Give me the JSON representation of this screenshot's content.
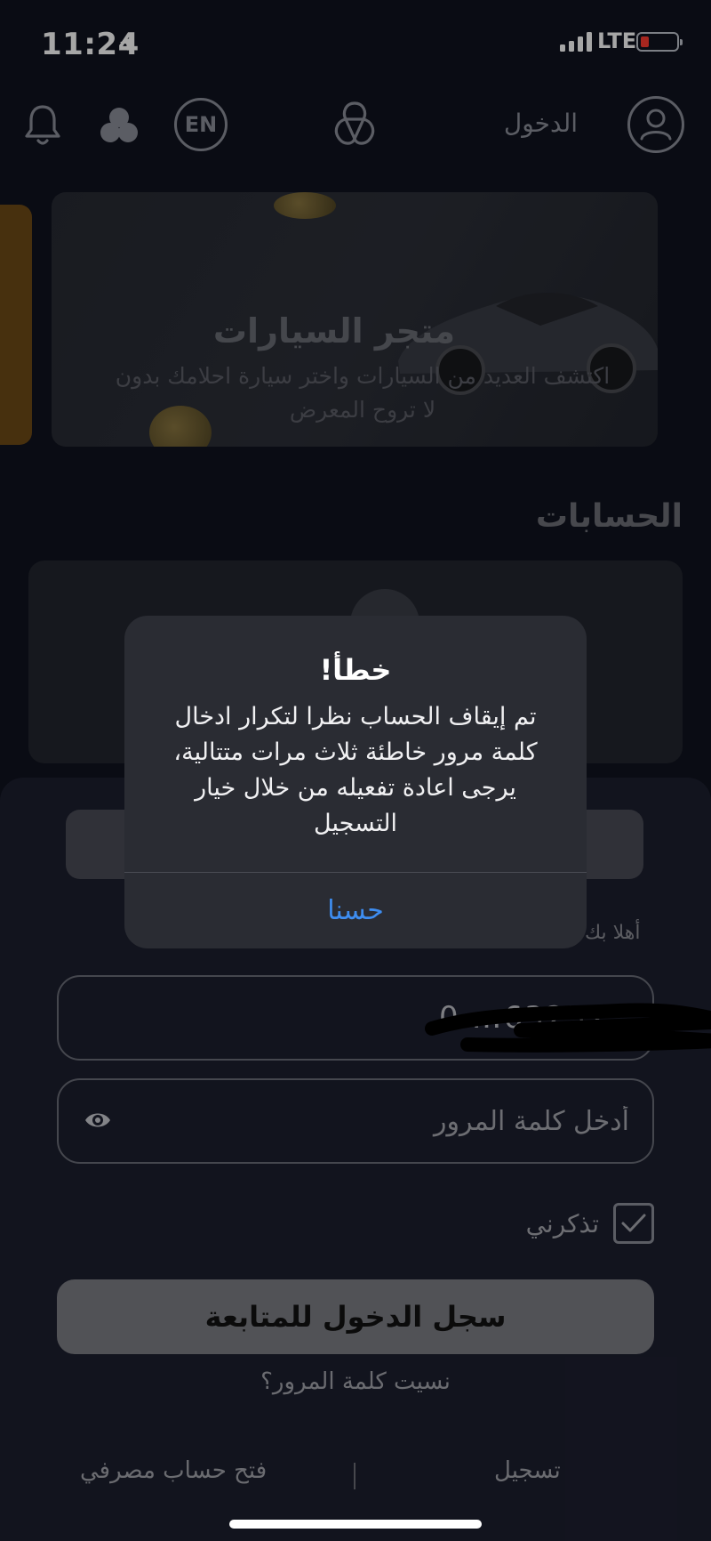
{
  "status_bar": {
    "time": "11:24",
    "network": "LTE",
    "battery_level": 0.15
  },
  "header": {
    "language_label": "EN",
    "login_label": "الدخول"
  },
  "banner": {
    "title": "متجر السيارات",
    "subtitle": "اكتشف العديد من السيارات واختر سيارة احلامك بدون لا تروح المعرض"
  },
  "accounts": {
    "title": "الحسابات"
  },
  "login_form": {
    "greeting": "أهلا بك",
    "phone_partial": "0 …63252",
    "password_placeholder": "أدخل كلمة المرور",
    "remember_label": "تذكرني",
    "remember_checked": true,
    "submit_label": "سجل الدخول للمتابعة",
    "forgot_label": "نسيت كلمة المرور؟",
    "register_label": "تسجيل",
    "open_account_label": "فتح حساب مصرفي"
  },
  "alert": {
    "title": "خطأ!",
    "message": "تم إيقاف الحساب نظرا لتكرار ادخال كلمة مرور خاطئة ثلاث مرات متتالية، يرجى اعادة تفعيله من خلال خيار التسجيل",
    "ok_label": "حسنا",
    "accent": "#3e8df0"
  }
}
